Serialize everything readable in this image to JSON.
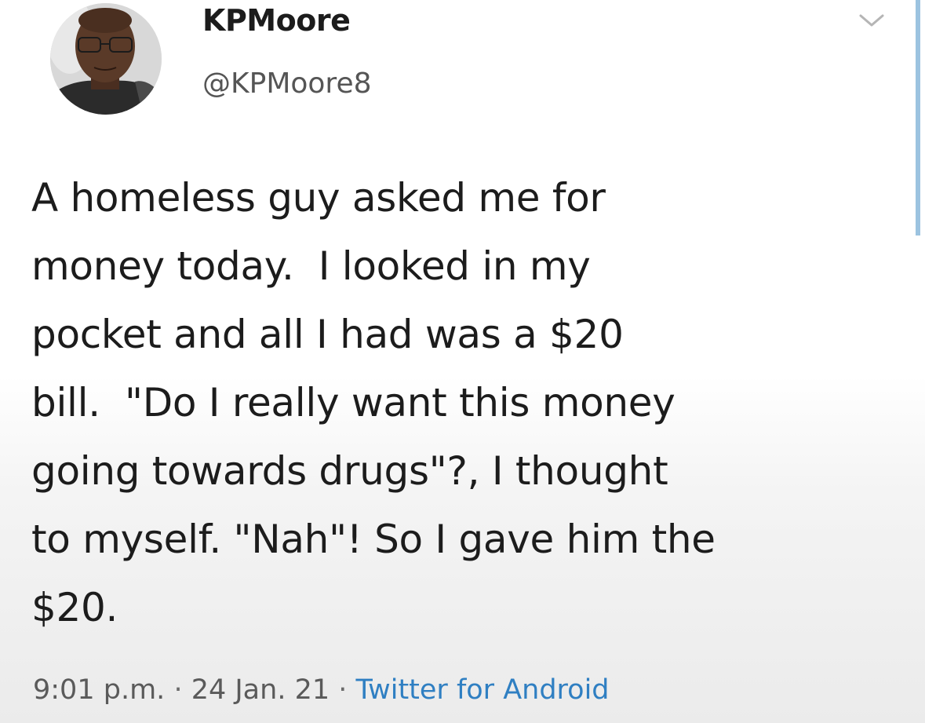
{
  "author": {
    "display_name": "KPMoore",
    "handle": "@KPMoore8"
  },
  "tweet": {
    "text": "A homeless guy asked me for\nmoney today.  I looked in my\npocket and all I had was a $20\nbill.  \"Do I really want this money\ngoing towards drugs\"?, I thought\nto myself. \"Nah\"! So I gave him the\n$20."
  },
  "meta": {
    "time": "9:01 p.m.",
    "separator": "·",
    "date": "24 Jan. 21",
    "source": "Twitter for Android"
  },
  "icons": {
    "menu": "chevron-down-icon",
    "avatar": "profile-photo"
  },
  "colors": {
    "link": "#2f7fc2",
    "text": "#1c1c1c",
    "muted": "#5a5a5a",
    "accent_bar": "#9cc3e0"
  }
}
